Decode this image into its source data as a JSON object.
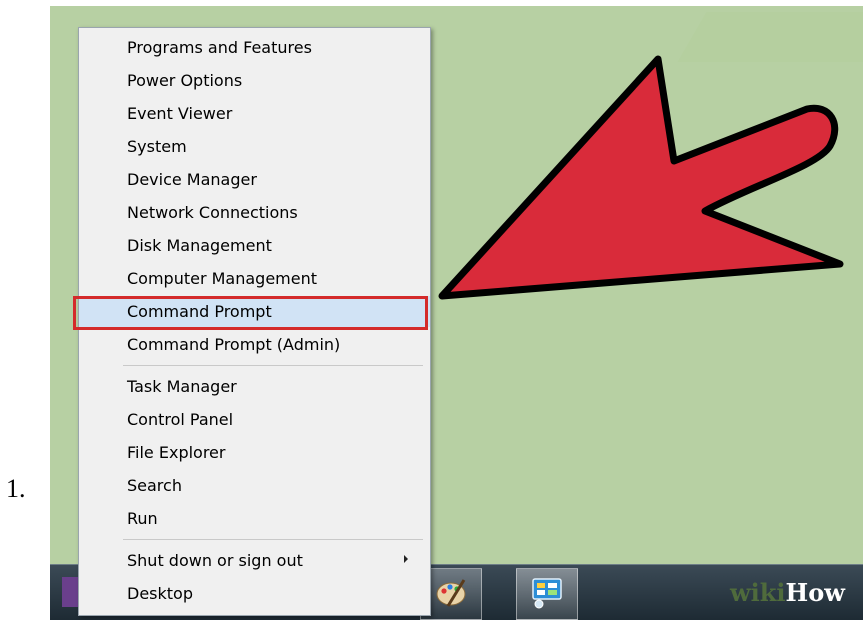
{
  "list_number": "1.",
  "menu": {
    "groups": [
      [
        {
          "label": "Programs and Features"
        },
        {
          "label": "Power Options"
        },
        {
          "label": "Event Viewer"
        },
        {
          "label": "System"
        },
        {
          "label": "Device Manager"
        },
        {
          "label": "Network Connections"
        },
        {
          "label": "Disk Management"
        },
        {
          "label": "Computer Management"
        },
        {
          "label": "Command Prompt",
          "highlighted": true
        },
        {
          "label": "Command Prompt (Admin)"
        }
      ],
      [
        {
          "label": "Task Manager"
        },
        {
          "label": "Control Panel"
        },
        {
          "label": "File Explorer"
        },
        {
          "label": "Search"
        },
        {
          "label": "Run"
        }
      ],
      [
        {
          "label": "Shut down or sign out",
          "has_submenu": true
        },
        {
          "label": "Desktop"
        }
      ]
    ]
  },
  "annotation": {
    "arrow_color": "#d92b3a",
    "arrow_outline": "#000000",
    "highlight_box_color": "#d42b2b"
  },
  "taskbar": {
    "icons": [
      "start-icon",
      "paint-icon",
      "control-panel-icon"
    ]
  },
  "watermark": {
    "part1": "wiki",
    "part2": "How"
  },
  "colors": {
    "desktop": "#b7d0a3",
    "menu_background": "#f0f0f0",
    "selection": "#d1e3f5"
  }
}
